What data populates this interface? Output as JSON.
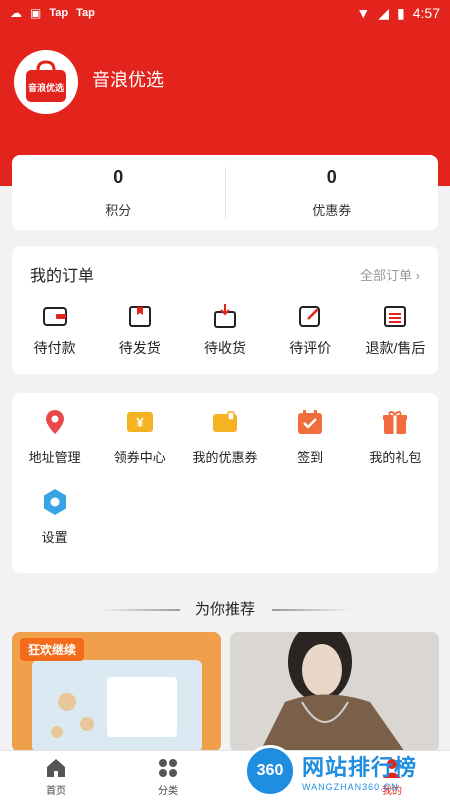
{
  "status_bar": {
    "left_items": [
      "Tap",
      "Tap"
    ],
    "time": "4:57"
  },
  "header": {
    "app_name": "音浪优选",
    "avatar_text": "音浪优选"
  },
  "stats": [
    {
      "value": "0",
      "label": "积分"
    },
    {
      "value": "0",
      "label": "优惠券"
    }
  ],
  "orders": {
    "title": "我的订单",
    "all_label": "全部订单",
    "items": [
      {
        "label": "待付款",
        "icon": "wallet-icon"
      },
      {
        "label": "待发货",
        "icon": "package-icon"
      },
      {
        "label": "待收货",
        "icon": "receive-box-icon"
      },
      {
        "label": "待评价",
        "icon": "edit-icon"
      },
      {
        "label": "退款/售后",
        "icon": "refund-list-icon"
      }
    ]
  },
  "services": [
    {
      "label": "地址管理",
      "icon": "location-pin-icon",
      "color": "#e84a4a"
    },
    {
      "label": "领券中心",
      "icon": "coupon-yen-icon",
      "color": "#f5b321"
    },
    {
      "label": "我的优惠券",
      "icon": "wallet-card-icon",
      "color": "#f5b321"
    },
    {
      "label": "签到",
      "icon": "calendar-check-icon",
      "color": "#f26d3d"
    },
    {
      "label": "我的礼包",
      "icon": "gift-icon",
      "color": "#f26d3d"
    },
    {
      "label": "设置",
      "icon": "settings-icon",
      "color": "#3aa3e6"
    }
  ],
  "recommend": {
    "title": "为你推荐"
  },
  "products": [
    {
      "promo_text": "狂欢继续"
    },
    {
      "promo_text": ""
    }
  ],
  "tabbar": [
    {
      "label": "首页",
      "icon": "home-icon"
    },
    {
      "label": "分类",
      "icon": "category-icon"
    },
    {
      "label": "",
      "icon": "cart-icon"
    },
    {
      "label": "我的",
      "icon": "user-icon"
    }
  ],
  "watermark": {
    "badge": "360",
    "title": "网站排行榜",
    "sub": "WANGZHAN360.CN"
  },
  "colors": {
    "primary": "#e3241c",
    "background": "#f2f2f2"
  }
}
